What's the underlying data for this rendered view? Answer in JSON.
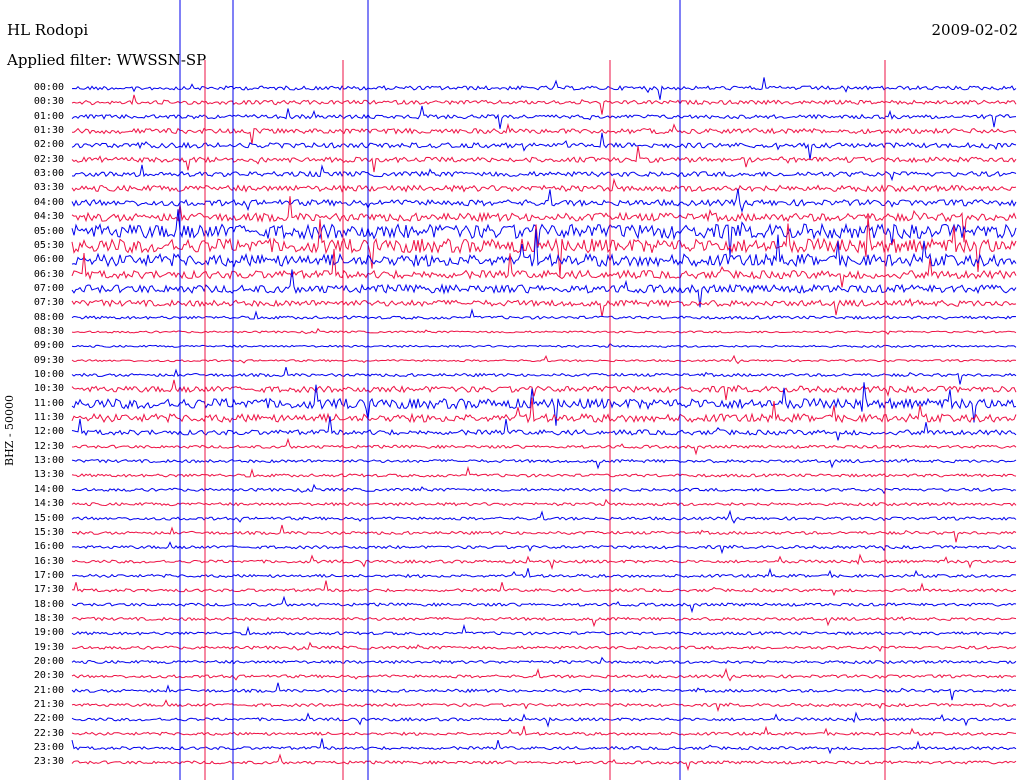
{
  "header": {
    "station": "HL Rodopi",
    "filter": "Applied filter: WWSSN-SP",
    "date": "2009-02-02"
  },
  "channel_label": "BHZ - 50000",
  "time_labels": [
    "00:00",
    "00:30",
    "01:00",
    "01:30",
    "02:00",
    "02:30",
    "03:00",
    "03:30",
    "04:00",
    "04:30",
    "05:00",
    "05:30",
    "06:00",
    "06:30",
    "07:00",
    "07:30",
    "08:00",
    "08:30",
    "09:00",
    "09:30",
    "10:00",
    "10:30",
    "11:00",
    "11:30",
    "12:00",
    "12:30",
    "13:00",
    "13:30",
    "14:00",
    "14:30",
    "15:00",
    "15:30",
    "16:00",
    "16:30",
    "17:00",
    "17:30",
    "18:00",
    "18:30",
    "19:00",
    "19:30",
    "20:00",
    "20:30",
    "21:00",
    "21:30",
    "22:00",
    "22:30",
    "23:00",
    "23:30"
  ],
  "colors": {
    "trace_a": "#0000ee",
    "trace_b": "#ee1144",
    "background": "#ffffff",
    "text": "#000000"
  },
  "trace": {
    "type": "helicorder",
    "rows_per_day": 48,
    "minutes_per_row": 30,
    "color_order": [
      "trace_a",
      "trace_b"
    ],
    "noise_level_by_row": [
      4,
      4,
      4,
      5,
      5,
      5,
      5,
      6,
      6,
      8,
      14,
      14,
      12,
      8,
      8,
      6,
      3,
      2,
      2,
      2,
      3,
      6,
      10,
      8,
      5,
      3,
      3,
      3,
      3,
      3,
      3,
      3,
      3,
      3,
      3,
      3,
      3,
      3,
      3,
      3,
      3,
      3,
      3,
      3,
      3,
      3,
      3,
      3
    ]
  }
}
